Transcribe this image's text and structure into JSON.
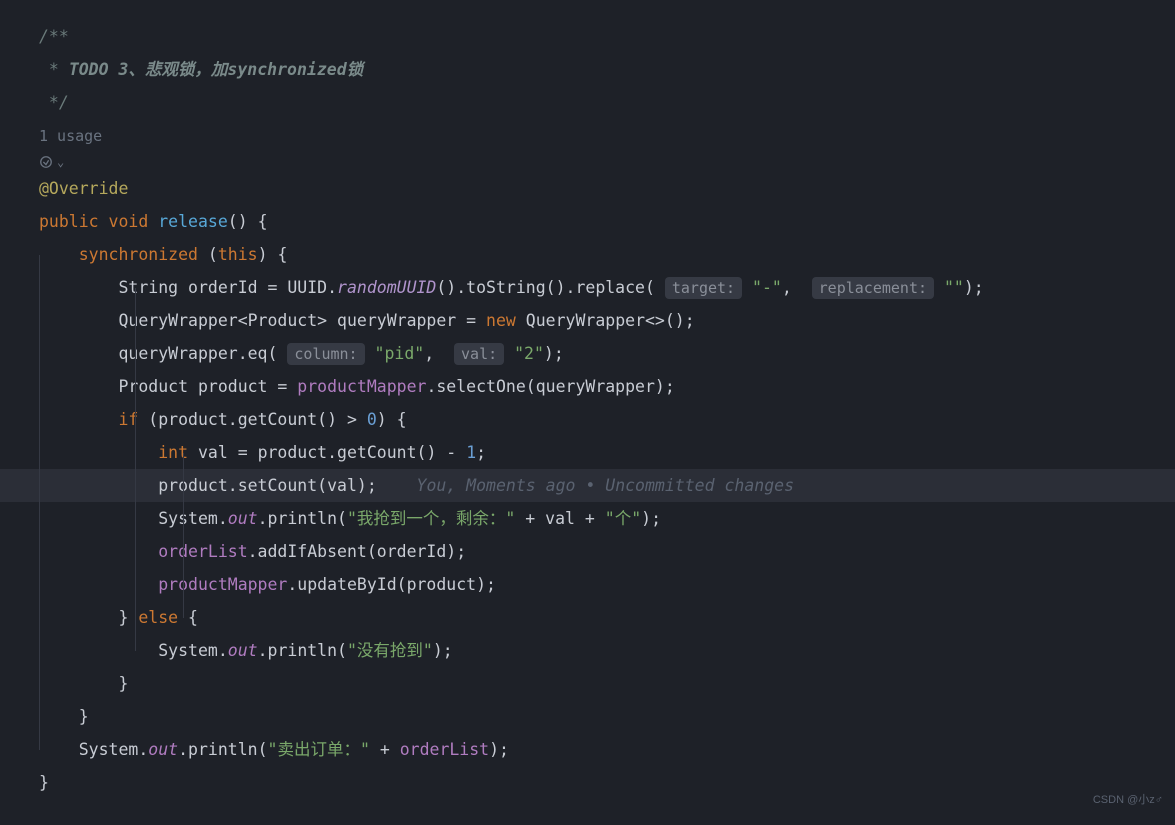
{
  "comment": {
    "line1": "/**",
    "line2_prefix": " * ",
    "line2_todo": "TODO 3、悲观锁，加synchronized锁",
    "line3": " */"
  },
  "usage": "1 usage",
  "annotation": "@Override",
  "signature": {
    "public": "public",
    "void": "void",
    "method": "release",
    "rest": "() {"
  },
  "sync": {
    "kw": "synchronized",
    "open": " (",
    "this": "this",
    "close": ") {"
  },
  "l1": {
    "p1": "String orderId = UUID.",
    "method": "randomUUID",
    "p2": "().toString().replace(",
    "hint1": "target:",
    "s1": "\"-\"",
    "comma": ", ",
    "hint2": "replacement:",
    "s2": "\"\"",
    "end": ");"
  },
  "l2": {
    "p1": "QueryWrapper<Product> queryWrapper = ",
    "new": "new",
    "p2": " QueryWrapper<>();"
  },
  "l3": {
    "p1": "queryWrapper.eq(",
    "hint1": "column:",
    "s1": "\"pid\"",
    "comma": ", ",
    "hint2": "val:",
    "s2": "\"2\"",
    "end": ");"
  },
  "l4": {
    "p1": "Product product = ",
    "field": "productMapper",
    "p2": ".selectOne(queryWrapper);"
  },
  "l5": {
    "if": "if",
    "p1": " (product.getCount() > ",
    "num": "0",
    "p2": ") {"
  },
  "l6": {
    "int": "int",
    "p1": " val = product.getCount() - ",
    "num": "1",
    "p2": ";"
  },
  "l7": {
    "p1": "product.setCount(val);",
    "hint": "You, Moments ago • Uncommitted changes"
  },
  "l8": {
    "p1": "System.",
    "out": "out",
    "p2": ".println(",
    "s1": "\"我抢到一个，剩余：\"",
    "p3": " + val + ",
    "s2": "\"个\"",
    "end": ");"
  },
  "l9": {
    "field": "orderList",
    "p1": ".addIfAbsent(orderId);"
  },
  "l10": {
    "field": "productMapper",
    "p1": ".updateById(product);"
  },
  "l11": {
    "close": "} ",
    "else": "else",
    "open": " {"
  },
  "l12": {
    "p1": "System.",
    "out": "out",
    "p2": ".println(",
    "s1": "\"没有抢到\"",
    "end": ");"
  },
  "l13": "}",
  "l14": "}",
  "l15": {
    "p1": "System.",
    "out": "out",
    "p2": ".println(",
    "s1": "\"卖出订单：\"",
    "p3": " + ",
    "field": "orderList",
    "end": ");"
  },
  "l16": "}",
  "watermark": "CSDN @小z♂"
}
